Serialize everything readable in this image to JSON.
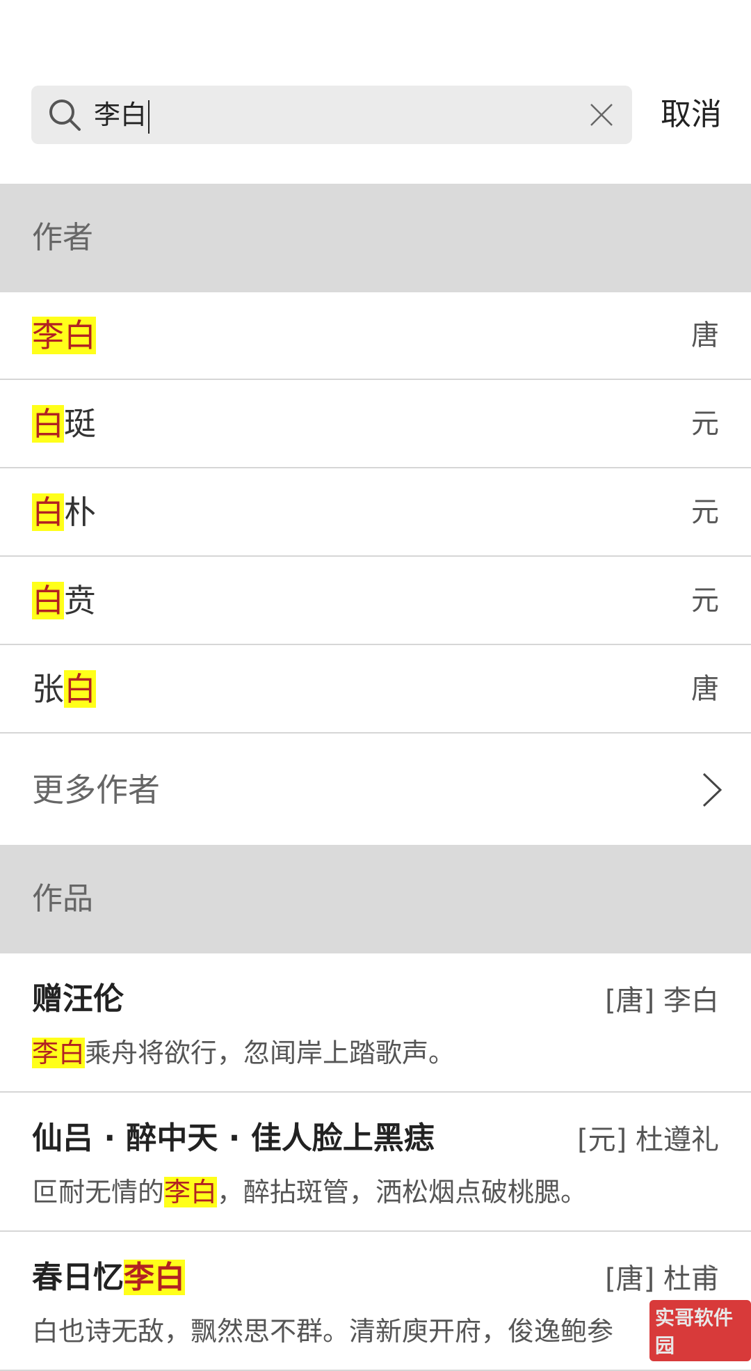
{
  "search": {
    "query": "李白",
    "cancel_label": "取消"
  },
  "sections": {
    "authors_header": "作者",
    "works_header": "作品"
  },
  "authors": [
    {
      "parts": [
        {
          "t": "李白",
          "hl": true
        }
      ],
      "dynasty": "唐"
    },
    {
      "parts": [
        {
          "t": "白",
          "hl": true
        },
        {
          "t": "珽",
          "hl": false
        }
      ],
      "dynasty": "元"
    },
    {
      "parts": [
        {
          "t": "白",
          "hl": true
        },
        {
          "t": "朴",
          "hl": false
        }
      ],
      "dynasty": "元"
    },
    {
      "parts": [
        {
          "t": "白",
          "hl": true
        },
        {
          "t": "贲",
          "hl": false
        }
      ],
      "dynasty": "元"
    },
    {
      "parts": [
        {
          "t": "张",
          "hl": false
        },
        {
          "t": "白",
          "hl": true
        }
      ],
      "dynasty": "唐"
    }
  ],
  "more_authors_label": "更多作者",
  "works": [
    {
      "title": [
        {
          "t": "赠汪伦",
          "hl": false
        }
      ],
      "author": "[唐] 李白",
      "line": [
        {
          "t": "李白",
          "hl": true
        },
        {
          "t": "乘舟将欲行，忽闻岸上踏歌声。",
          "hl": false
        }
      ]
    },
    {
      "title": [
        {
          "t": "仙吕 · 醉中天 · 佳人脸上黑痣",
          "hl": false
        }
      ],
      "author": "[元] 杜遵礼",
      "line": [
        {
          "t": "叵耐无情的",
          "hl": false
        },
        {
          "t": "李白",
          "hl": true
        },
        {
          "t": "，醉拈斑管，洒松烟点破桃腮。",
          "hl": false
        }
      ]
    },
    {
      "title": [
        {
          "t": "春日忆",
          "hl": false
        },
        {
          "t": "李白",
          "hl": true
        }
      ],
      "author": "[唐] 杜甫",
      "line": [
        {
          "t": "白也诗无敌，飘然思不群。清新庾开府，俊逸鲍参",
          "hl": false
        }
      ]
    }
  ],
  "watermark": "实哥软件园",
  "colors": {
    "highlight_bg": "#ffff1a",
    "highlight_text": "#b22222",
    "section_bg": "#dadada",
    "search_bg": "#ebebeb"
  },
  "icons": {
    "search": "search-icon",
    "clear": "close-icon",
    "more": "chevron-right-icon"
  }
}
